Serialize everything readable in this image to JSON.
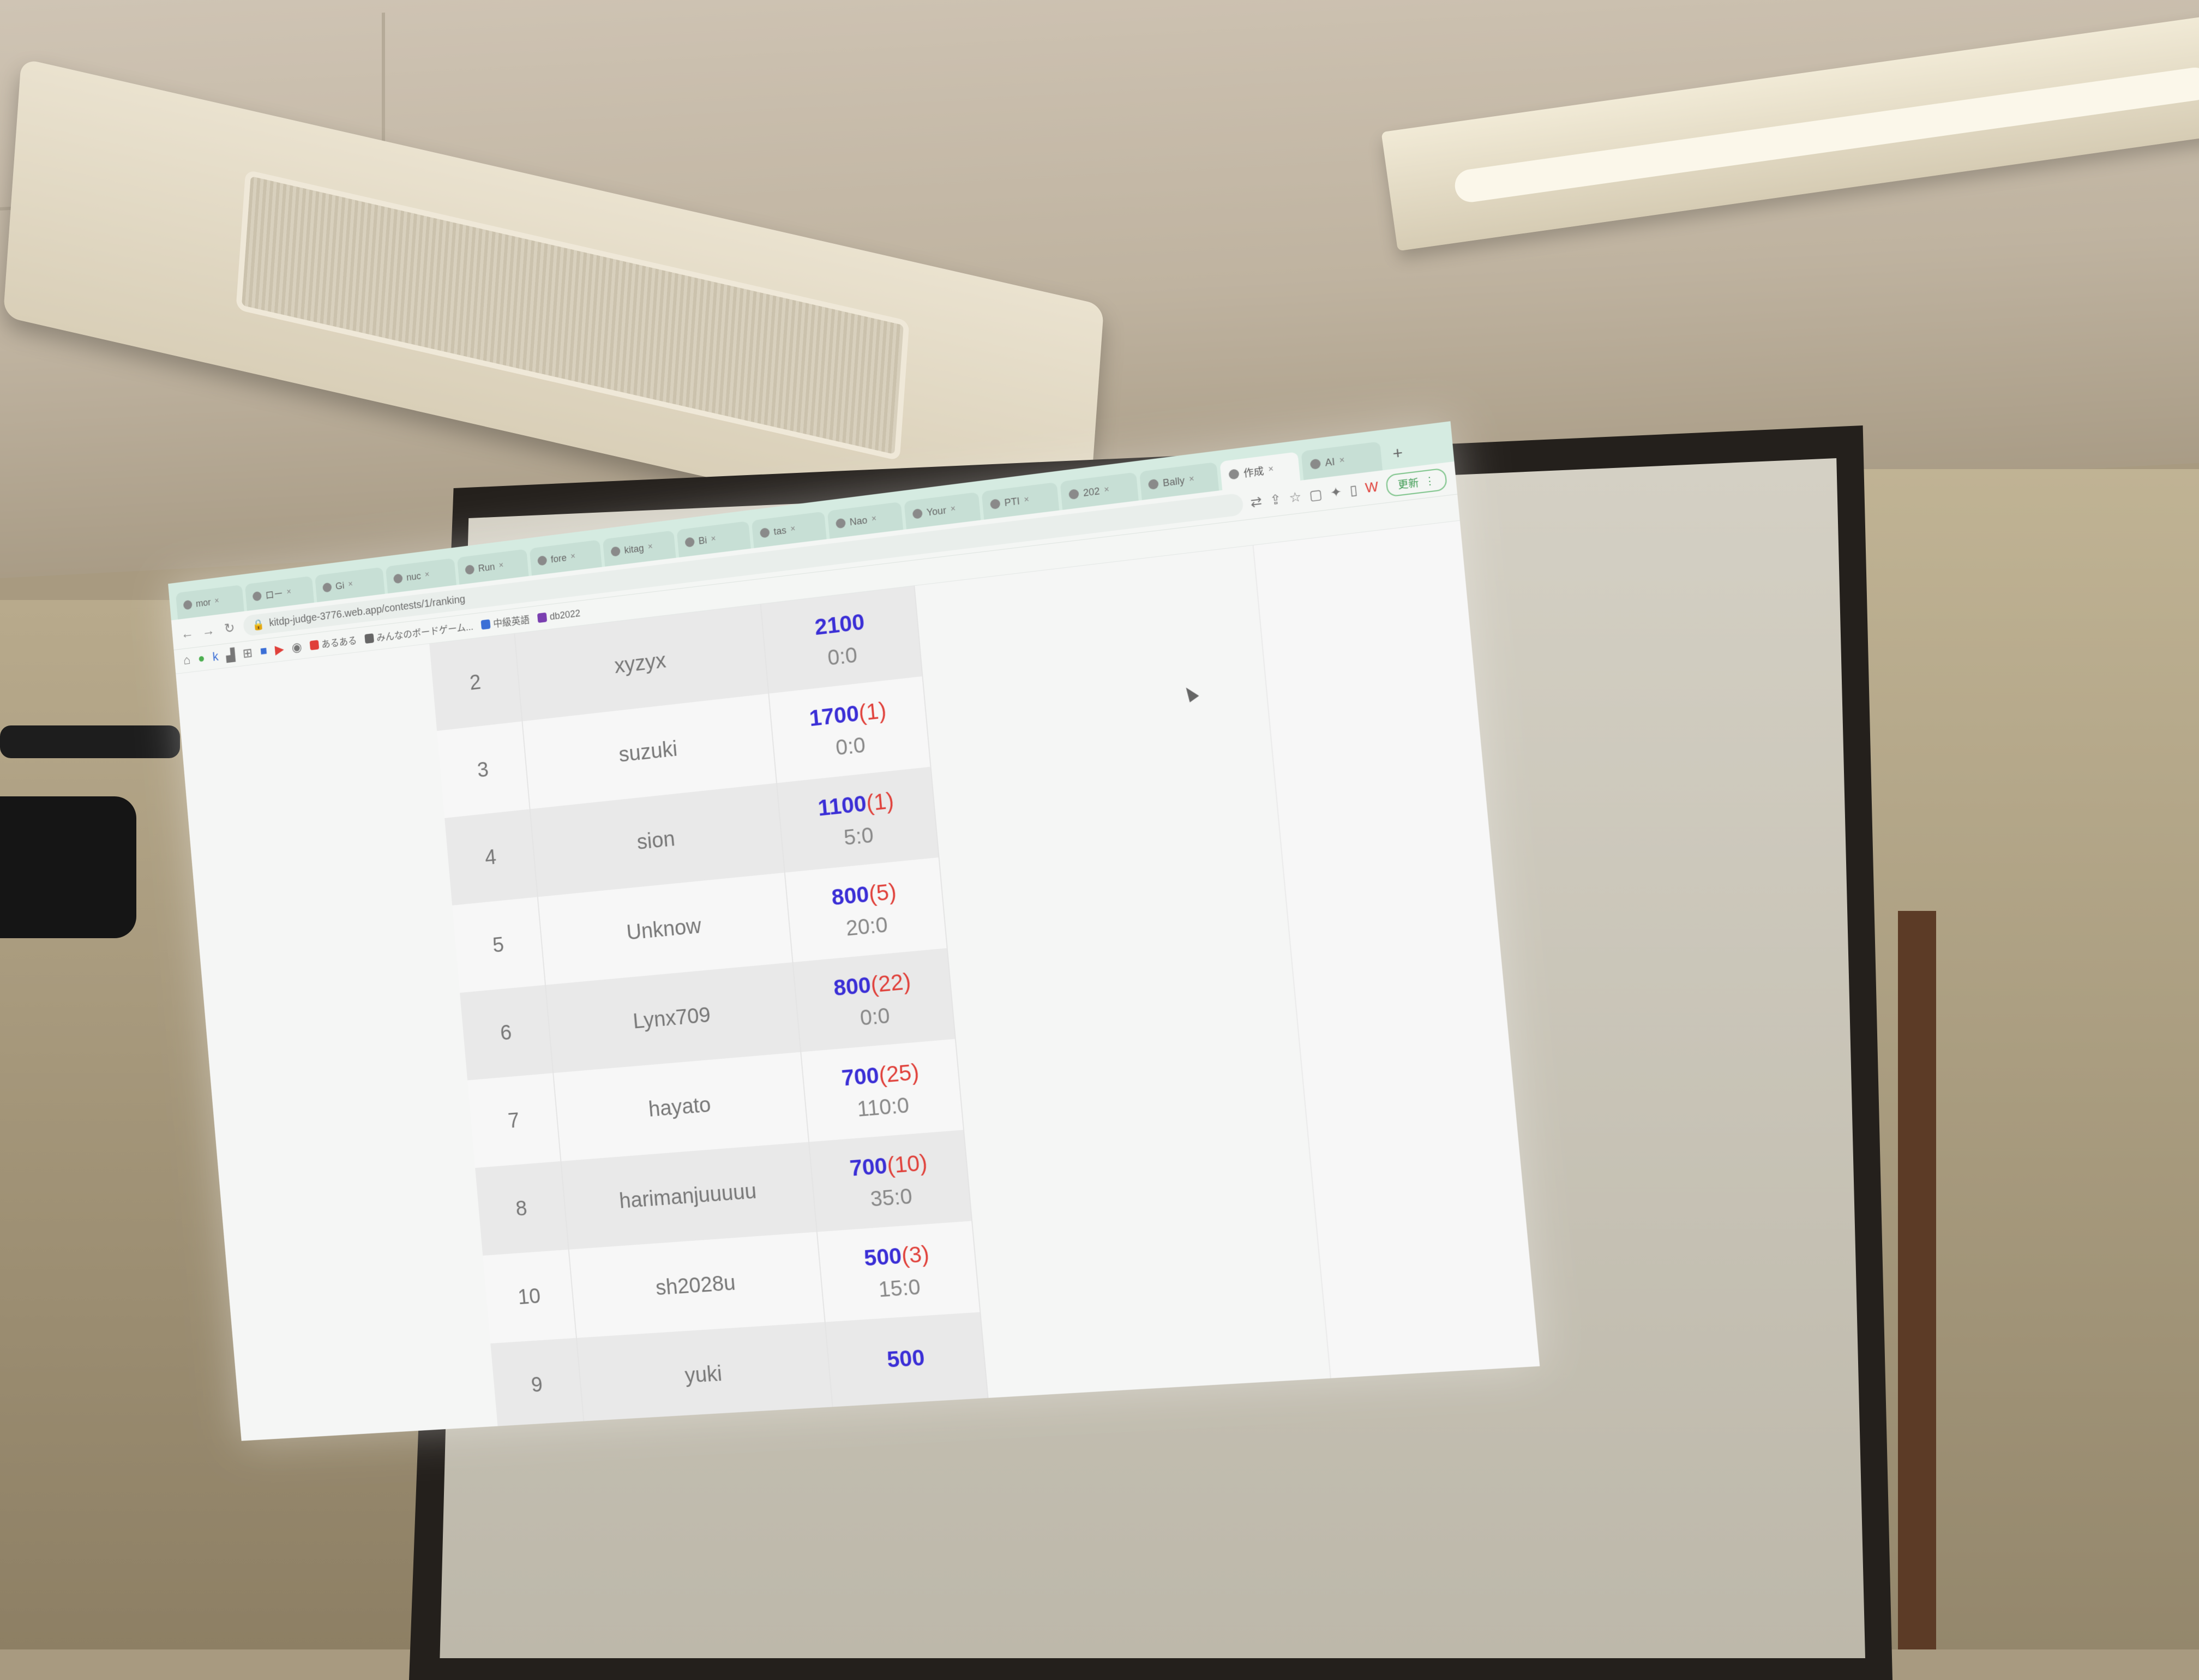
{
  "tabs": [
    {
      "label": "mor",
      "close": "×"
    },
    {
      "label": "ロー",
      "close": "×"
    },
    {
      "label": "Gi",
      "close": "×"
    },
    {
      "label": "nuc",
      "close": "×"
    },
    {
      "label": "Run",
      "close": "×"
    },
    {
      "label": "fore",
      "close": "×"
    },
    {
      "label": "kitag",
      "close": "×"
    },
    {
      "label": "Bi",
      "close": "×"
    },
    {
      "label": "tas",
      "close": "×"
    },
    {
      "label": "Nao",
      "close": "×"
    },
    {
      "label": "Your",
      "close": "×"
    },
    {
      "label": "PTI",
      "close": "×"
    },
    {
      "label": "202",
      "close": "×"
    },
    {
      "label": "Bally",
      "close": "×"
    },
    {
      "label": "作成",
      "close": "×",
      "active": true
    },
    {
      "label": "AI",
      "close": "×"
    }
  ],
  "toolbar": {
    "url": "kitdp-judge-3776.web.app/contests/1/ranking",
    "update_label": "更新"
  },
  "bookmarks": [
    {
      "label": "あるある",
      "color": "#e0403a"
    },
    {
      "label": "みんなのボードゲーム...",
      "color": "#666666"
    },
    {
      "label": "中級英語",
      "color": "#3b6fd6"
    },
    {
      "label": "db2022",
      "color": "#7a3fb0"
    }
  ],
  "ranking": [
    {
      "rank": "2",
      "name": "xyzyx",
      "score": "2100",
      "penalty": "",
      "time": "0:0"
    },
    {
      "rank": "3",
      "name": "suzuki",
      "score": "1700",
      "penalty": "(1)",
      "time": "0:0"
    },
    {
      "rank": "4",
      "name": "sion",
      "score": "1100",
      "penalty": "(1)",
      "time": "5:0"
    },
    {
      "rank": "5",
      "name": "Unknow",
      "score": "800",
      "penalty": "(5)",
      "time": "20:0"
    },
    {
      "rank": "6",
      "name": "Lynx709",
      "score": "800",
      "penalty": "(22)",
      "time": "0:0"
    },
    {
      "rank": "7",
      "name": "hayato",
      "score": "700",
      "penalty": "(25)",
      "time": "110:0"
    },
    {
      "rank": "8",
      "name": "harimanjuuuuu",
      "score": "700",
      "penalty": "(10)",
      "time": "35:0"
    },
    {
      "rank": "10",
      "name": "sh2028u",
      "score": "500",
      "penalty": "(3)",
      "time": "15:0"
    },
    {
      "rank": "9",
      "name": "yuki",
      "score": "500",
      "penalty": "",
      "time": ""
    }
  ]
}
